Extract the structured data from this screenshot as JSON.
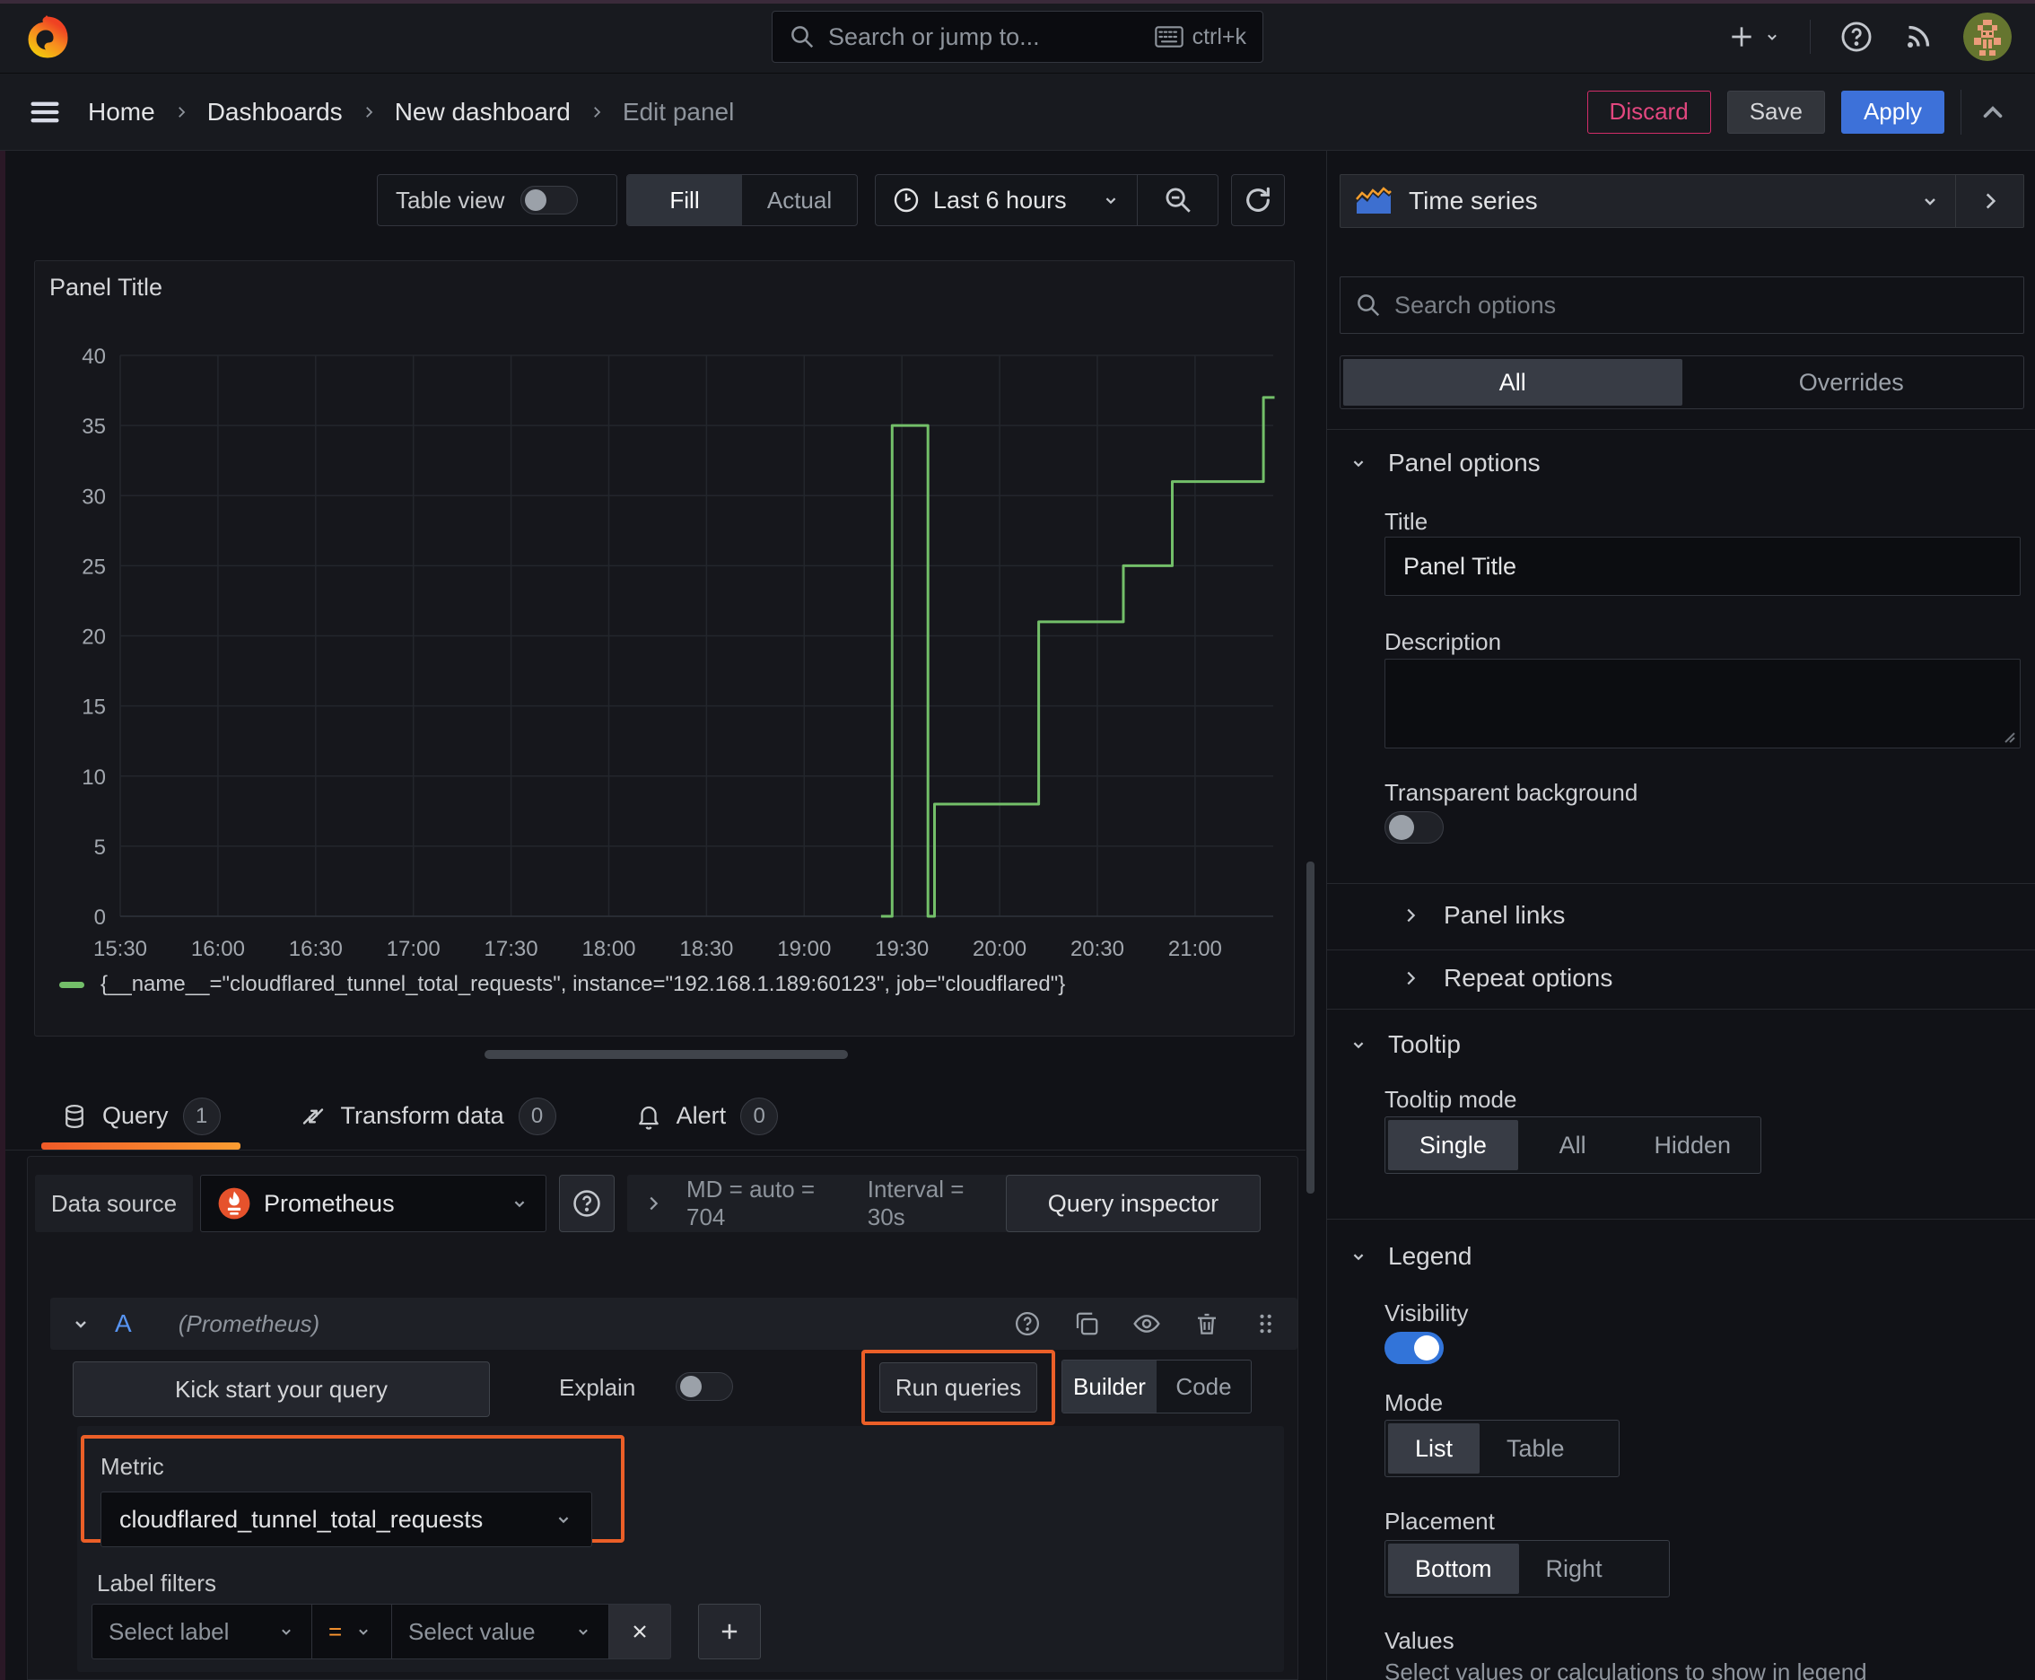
{
  "colors": {
    "accent_orange_highlight": "#eb5f28",
    "apply_blue": "#3d71d9",
    "discard_pink": "#e0226e",
    "series_green": "#73bf69",
    "toggle_on_blue": "#3274d9",
    "tab_underline_orange": "#f05a28",
    "ref_id_blue": "#5794f2",
    "operator_orange": "#ff9830"
  },
  "topbar": {
    "search_placeholder": "Search or jump to...",
    "shortcut": "ctrl+k"
  },
  "breadcrumb": {
    "items": [
      "Home",
      "Dashboards",
      "New dashboard",
      "Edit panel"
    ]
  },
  "actions": {
    "discard": "Discard",
    "save": "Save",
    "apply": "Apply"
  },
  "toolbar": {
    "table_view_label": "Table view",
    "fill_label": "Fill",
    "actual_label": "Actual",
    "time_range_label": "Last 6 hours"
  },
  "viz_picker": {
    "label": "Time series"
  },
  "panel": {
    "title": "Panel Title"
  },
  "chart_data": {
    "type": "line",
    "line_style": "stepped",
    "title": "Panel Title",
    "x_ticks": [
      "15:30",
      "16:00",
      "16:30",
      "17:00",
      "17:30",
      "18:00",
      "18:30",
      "19:00",
      "19:30",
      "20:00",
      "20:30",
      "21:00"
    ],
    "y_ticks": [
      0,
      5,
      10,
      15,
      20,
      25,
      30,
      35,
      40
    ],
    "ylim": [
      0,
      40
    ],
    "x_range": [
      "15:30",
      "21:24"
    ],
    "grid": true,
    "legend_position": "bottom",
    "series": [
      {
        "name": "{__name__=\"cloudflared_tunnel_total_requests\", instance=\"192.168.1.189:60123\", job=\"cloudflared\"}",
        "color": "#73bf69",
        "points": [
          [
            "19:24",
            0
          ],
          [
            "19:27",
            0
          ],
          [
            "19:27",
            35
          ],
          [
            "19:38",
            35
          ],
          [
            "19:38",
            0
          ],
          [
            "19:40",
            0
          ],
          [
            "19:40",
            8
          ],
          [
            "20:12",
            8
          ],
          [
            "20:12",
            21
          ],
          [
            "20:38",
            21
          ],
          [
            "20:38",
            25
          ],
          [
            "20:53",
            25
          ],
          [
            "20:53",
            31
          ],
          [
            "21:21",
            31
          ],
          [
            "21:21",
            37
          ],
          [
            "21:24",
            37
          ]
        ]
      }
    ]
  },
  "tabs": {
    "query": "Query",
    "query_count": "1",
    "transform": "Transform data",
    "transform_count": "0",
    "alert": "Alert",
    "alert_count": "0"
  },
  "query": {
    "datasource_label": "Data source",
    "datasource_name": "Prometheus",
    "stats_md": "MD = auto = 704",
    "stats_interval": "Interval = 30s",
    "inspector_label": "Query inspector",
    "ref_id": "A",
    "ref_note": "(Prometheus)",
    "kick_start_label": "Kick start your query",
    "explain_label": "Explain",
    "run_queries_label": "Run queries",
    "builder_label": "Builder",
    "code_label": "Code",
    "metric_label": "Metric",
    "metric_value": "cloudflared_tunnel_total_requests",
    "label_filters_label": "Label filters",
    "select_label_placeholder": "Select label",
    "operator": "=",
    "select_value_placeholder": "Select value"
  },
  "options_pane": {
    "search_placeholder": "Search options",
    "tab_all": "All",
    "tab_overrides": "Overrides",
    "panel_options_title": "Panel options",
    "title_label": "Title",
    "title_value": "Panel Title",
    "description_label": "Description",
    "transparent_label": "Transparent background",
    "panel_links_title": "Panel links",
    "repeat_options_title": "Repeat options",
    "tooltip_title": "Tooltip",
    "tooltip_mode_label": "Tooltip mode",
    "tooltip_modes": [
      "Single",
      "All",
      "Hidden"
    ],
    "tooltip_selected": "Single",
    "legend_title": "Legend",
    "visibility_label": "Visibility",
    "mode_label": "Mode",
    "modes": [
      "List",
      "Table"
    ],
    "mode_selected": "List",
    "placement_label": "Placement",
    "placements": [
      "Bottom",
      "Right"
    ],
    "placement_selected": "Bottom",
    "values_label": "Values",
    "values_help": "Select values or calculations to show in legend"
  }
}
